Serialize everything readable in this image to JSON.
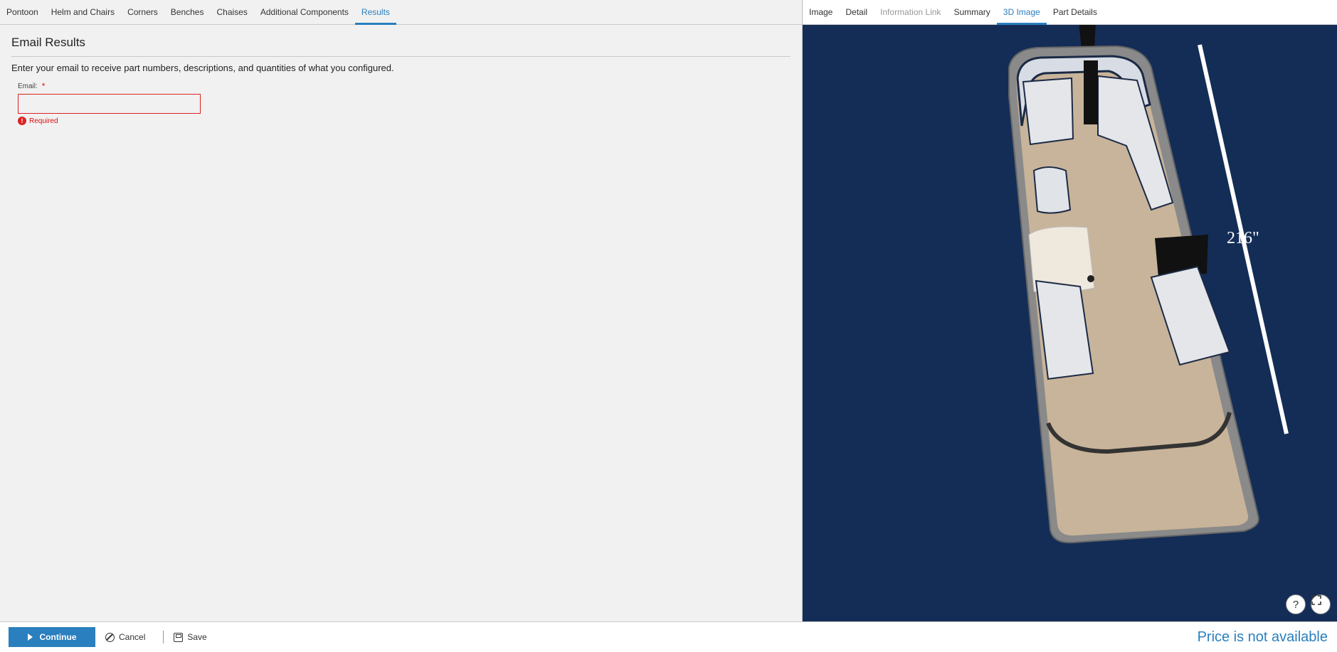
{
  "left_tabs": [
    {
      "label": "Pontoon"
    },
    {
      "label": "Helm and Chairs"
    },
    {
      "label": "Corners"
    },
    {
      "label": "Benches"
    },
    {
      "label": "Chaises"
    },
    {
      "label": "Additional Components"
    },
    {
      "label": "Results",
      "active": true
    }
  ],
  "section": {
    "title": "Email Results",
    "description": "Enter your email to receive part numbers, descriptions, and quantities of what you configured."
  },
  "email_field": {
    "label": "Email:",
    "required_marker": "*",
    "value": "",
    "placeholder": "",
    "error": "Required"
  },
  "right_tabs": [
    {
      "label": "Image"
    },
    {
      "label": "Detail"
    },
    {
      "label": "Information Link",
      "disabled": true
    },
    {
      "label": "Summary"
    },
    {
      "label": "3D Image",
      "active": true
    },
    {
      "label": "Part Details"
    }
  ],
  "viewer": {
    "dimension_label": "216\"",
    "help_label": "?",
    "background_color": "#142d57",
    "deck_color": "#c8b49a"
  },
  "footer": {
    "continue_label": "Continue",
    "cancel_label": "Cancel",
    "save_label": "Save",
    "price_text": "Price is not available"
  },
  "colors": {
    "accent": "#2a7fbe",
    "error": "#d22222"
  }
}
